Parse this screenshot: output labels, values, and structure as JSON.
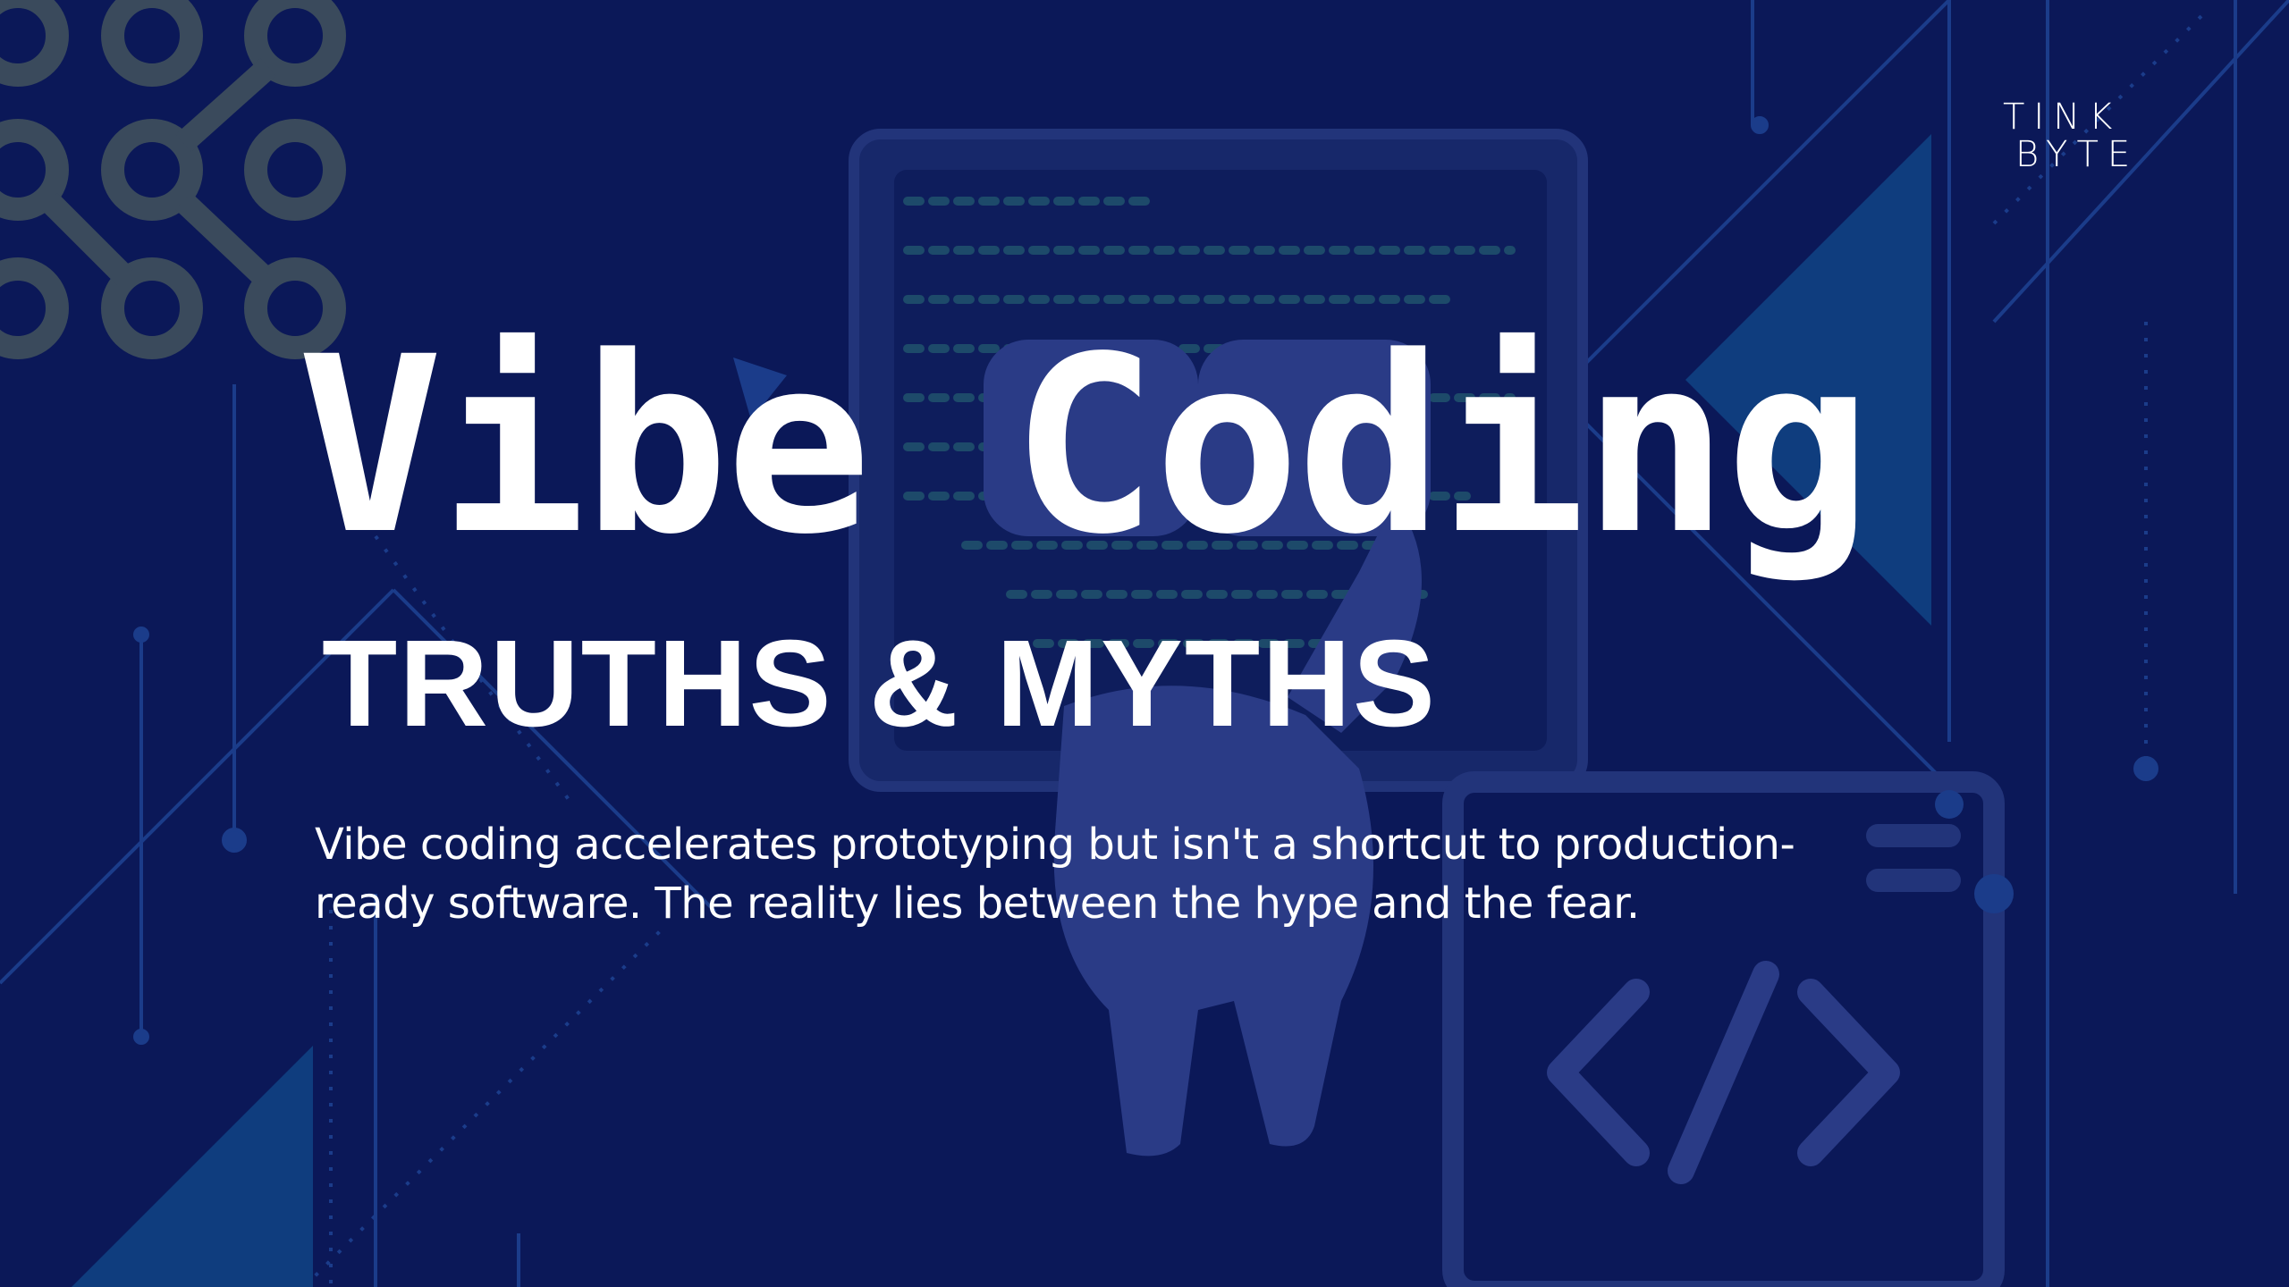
{
  "slide": {
    "title": "Vibe Coding",
    "subtitle": "TRUTHS & MYTHS",
    "description": "Vibe coding accelerates prototyping but isn't a shortcut to production-ready software. The reality lies between the hype and the fear."
  },
  "logo": {
    "line1": "TINK",
    "line2": "BYTE"
  },
  "colors": {
    "background": "#0b1858",
    "circuit_lines": "#1b3c8a",
    "node_grid": "#3a4a5c",
    "triangle_accent": "#0f3d7e",
    "illustration": "#2a3b86",
    "text": "#ffffff"
  },
  "decorations": {
    "corner_graphic": "node-grid-icon",
    "code_window": "code-window-icon",
    "character": "person-silhouette-icon",
    "code_tag": "code-brackets-icon"
  }
}
